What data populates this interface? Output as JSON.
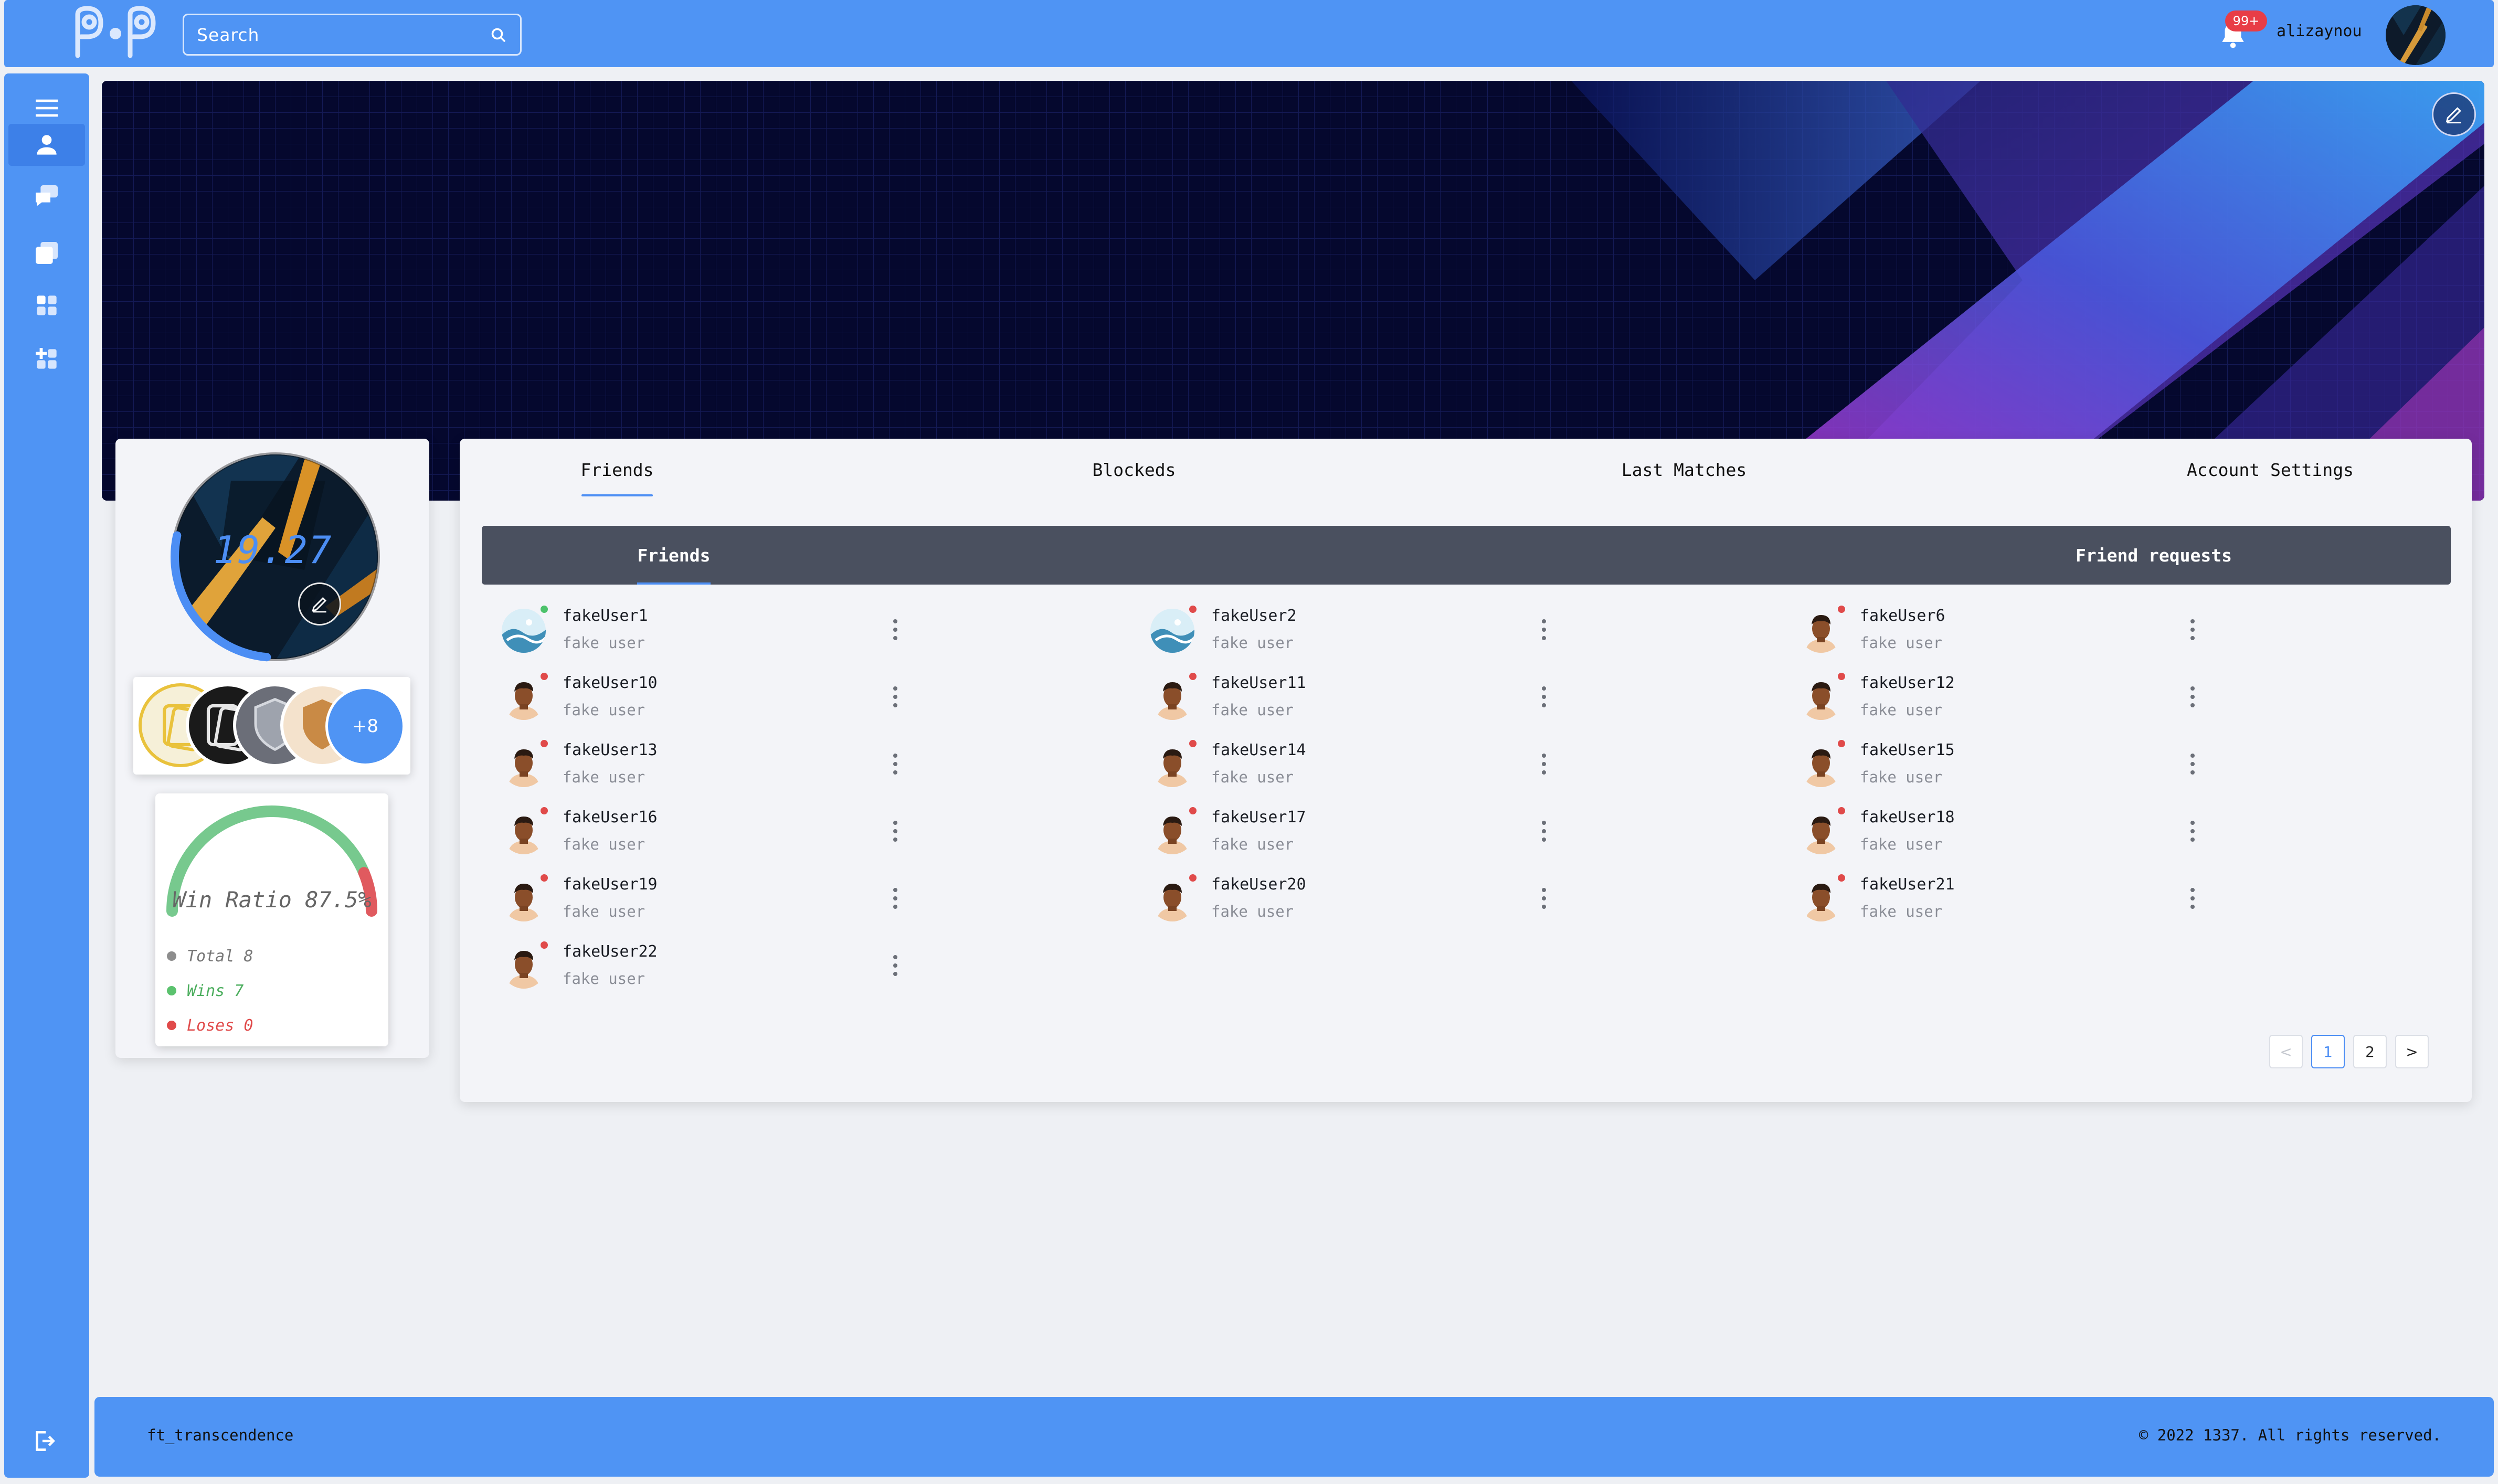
{
  "header": {
    "logo_alt": "PiP",
    "search_placeholder": "Search",
    "notification_badge": "99+",
    "username": "alizaynou"
  },
  "sidebar": {
    "items": [
      {
        "icon": "menu-icon",
        "active": false
      },
      {
        "icon": "profile-icon",
        "active": true
      },
      {
        "icon": "chat-icon",
        "active": false
      },
      {
        "icon": "rooms-icon",
        "active": false
      },
      {
        "icon": "apps-icon",
        "active": false
      },
      {
        "icon": "add-apps-icon",
        "active": false
      }
    ],
    "logout_icon": "logout-icon"
  },
  "profile": {
    "level": "19.27",
    "level_progress": 0.27,
    "achievements_more": "+8",
    "win_ratio_label": "Win Ratio 87.5%",
    "win_ratio": 87.5,
    "stats": {
      "total": "Total 8",
      "wins": "Wins 7",
      "loses": "Loses 0"
    }
  },
  "tabs": [
    {
      "label": "Friends",
      "active": true
    },
    {
      "label": "Blockeds",
      "active": false
    },
    {
      "label": "Last Matches",
      "active": false
    },
    {
      "label": "Account Settings",
      "active": false
    }
  ],
  "subtabs": [
    {
      "label": "Friends",
      "active": true
    },
    {
      "label": "Friend requests",
      "active": false
    }
  ],
  "friends": [
    {
      "name": "fakeUser1",
      "subtitle": "fake user",
      "status": "online",
      "avatar": "wave"
    },
    {
      "name": "fakeUser2",
      "subtitle": "fake user",
      "status": "offline",
      "avatar": "wave"
    },
    {
      "name": "fakeUser6",
      "subtitle": "fake user",
      "status": "offline",
      "avatar": "person"
    },
    {
      "name": "fakeUser10",
      "subtitle": "fake user",
      "status": "offline",
      "avatar": "person"
    },
    {
      "name": "fakeUser11",
      "subtitle": "fake user",
      "status": "offline",
      "avatar": "person"
    },
    {
      "name": "fakeUser12",
      "subtitle": "fake user",
      "status": "offline",
      "avatar": "person"
    },
    {
      "name": "fakeUser13",
      "subtitle": "fake user",
      "status": "offline",
      "avatar": "person"
    },
    {
      "name": "fakeUser14",
      "subtitle": "fake user",
      "status": "offline",
      "avatar": "person"
    },
    {
      "name": "fakeUser15",
      "subtitle": "fake user",
      "status": "offline",
      "avatar": "person"
    },
    {
      "name": "fakeUser16",
      "subtitle": "fake user",
      "status": "offline",
      "avatar": "person"
    },
    {
      "name": "fakeUser17",
      "subtitle": "fake user",
      "status": "offline",
      "avatar": "person"
    },
    {
      "name": "fakeUser18",
      "subtitle": "fake user",
      "status": "offline",
      "avatar": "person"
    },
    {
      "name": "fakeUser19",
      "subtitle": "fake user",
      "status": "offline",
      "avatar": "person"
    },
    {
      "name": "fakeUser20",
      "subtitle": "fake user",
      "status": "offline",
      "avatar": "person"
    },
    {
      "name": "fakeUser21",
      "subtitle": "fake user",
      "status": "offline",
      "avatar": "person"
    },
    {
      "name": "fakeUser22",
      "subtitle": "fake user",
      "status": "offline",
      "avatar": "person"
    }
  ],
  "pagination": {
    "prev": "<",
    "pages": [
      "1",
      "2"
    ],
    "current": "1",
    "next": ">"
  },
  "footer": {
    "left": "ft_transcendence",
    "right": "© 2022 1337. All rights reserved."
  },
  "colors": {
    "brand": "#4f94f4",
    "online": "#4cc26b",
    "offline": "#e04a4a",
    "subtab_bg": "#4a505f"
  }
}
